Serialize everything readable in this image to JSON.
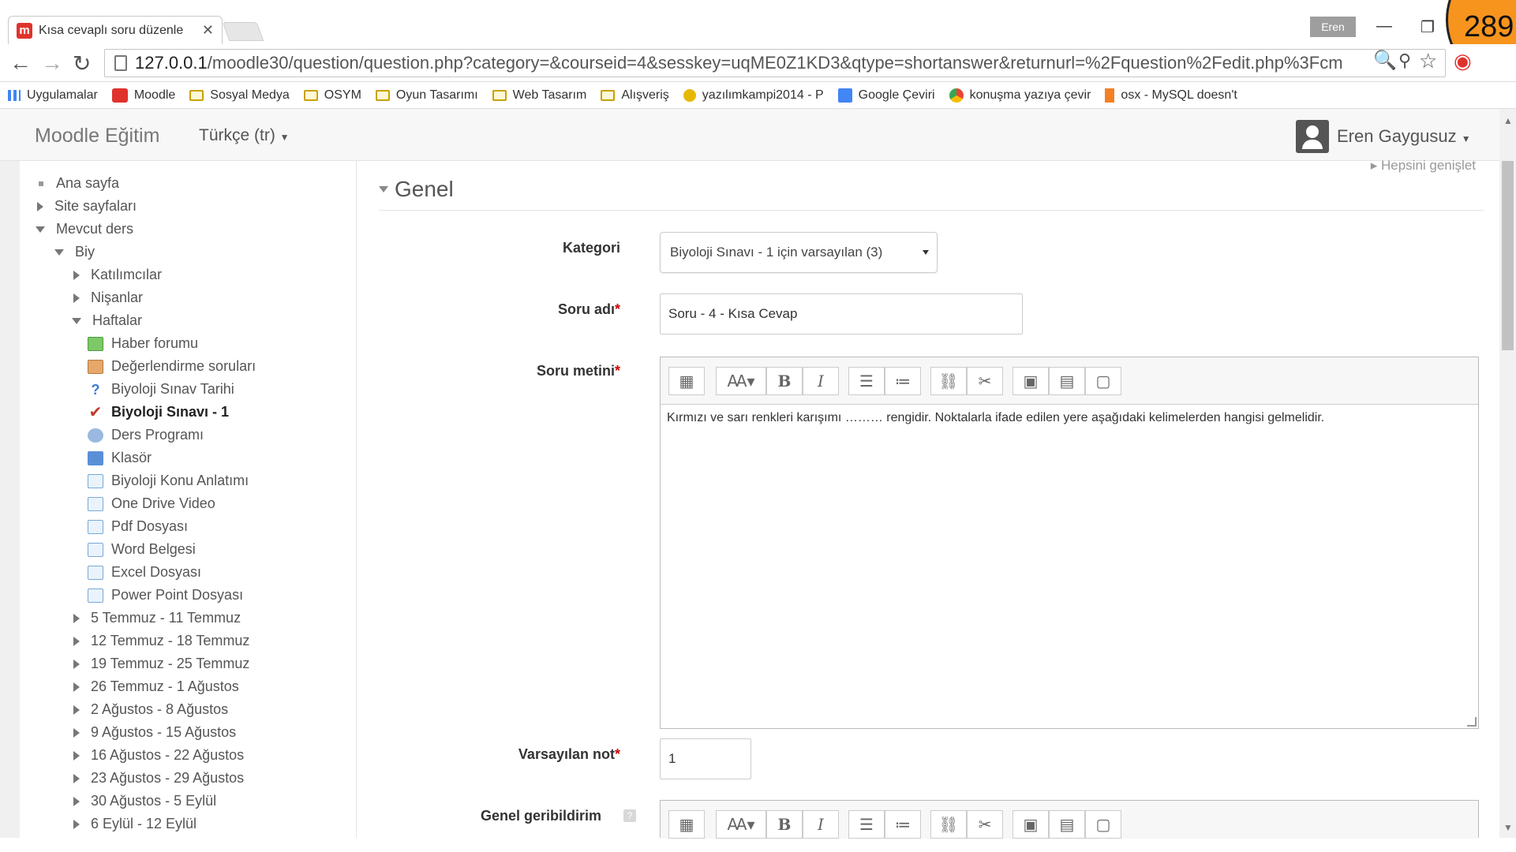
{
  "browser": {
    "tab_title": "Kısa cevaplı soru düzenle",
    "profile_name": "Eren",
    "url_host": "127.0.0.1",
    "url_rest": "/moodle30/question/question.php?category=&courseid=4&sesskey=uqME0Z1KD3&qtype=shortanswer&returnurl=%2Fquestion%2Fedit.php%3Fcm",
    "bookmarks": [
      "Uygulamalar",
      "Moodle",
      "Sosyal Medya",
      "OSYM",
      "Oyun Tasarımı",
      "Web Tasarım",
      "Alışveriş",
      "yazılımkampi2014 - P",
      "Google Çeviri",
      "konuşma yazıya çevir",
      "osx - MySQL doesn't"
    ]
  },
  "badge": {
    "number": "289"
  },
  "header": {
    "brand": "Moodle Eğitim",
    "language": "Türkçe (tr)",
    "user": "Eren Gaygusuz"
  },
  "nav": {
    "home": "Ana sayfa",
    "site_pages": "Site sayfaları",
    "current_course": "Mevcut ders",
    "course": "Biy",
    "participants": "Katılımcılar",
    "badges": "Nişanlar",
    "weeks": "Haftalar",
    "activities": [
      "Haber forumu",
      "Değerlendirme soruları",
      "Biyoloji Sınav Tarihi",
      "Biyoloji Sınavı - 1",
      "Ders Programı",
      "Klasör",
      "Biyoloji Konu Anlatımı",
      "One Drive Video",
      "Pdf Dosyası",
      "Word Belgesi",
      "Excel Dosyası",
      "Power Point Dosyası"
    ],
    "week_sections": [
      "5 Temmuz - 11 Temmuz",
      "12 Temmuz - 18 Temmuz",
      "19 Temmuz - 25 Temmuz",
      "26 Temmuz - 1 Ağustos",
      "2 Ağustos - 8 Ağustos",
      "9 Ağustos - 15 Ağustos",
      "16 Ağustos - 22 Ağustos",
      "23 Ağustos - 29 Ağustos",
      "30 Ağustos - 5 Eylül",
      "6 Eylül - 12 Eylül"
    ]
  },
  "form": {
    "expand_all": "Hepsini genişlet",
    "section": "Genel",
    "category_label": "Kategori",
    "category_value": "Biyoloji Sınavı - 1 için varsayılan (3)",
    "name_label": "Soru adı",
    "name_value": "Soru - 4 - Kısa Cevap",
    "text_label": "Soru metini",
    "text_value": "Kırmızı ve sarı renkleri karışımı ……… rengidir. Noktalarla ifade edilen yere aşağıdaki kelimelerden hangisi gelmelidir.",
    "mark_label": "Varsayılan not",
    "mark_value": "1",
    "feedback_label": "Genel geribildirim",
    "required_mark": "*"
  }
}
